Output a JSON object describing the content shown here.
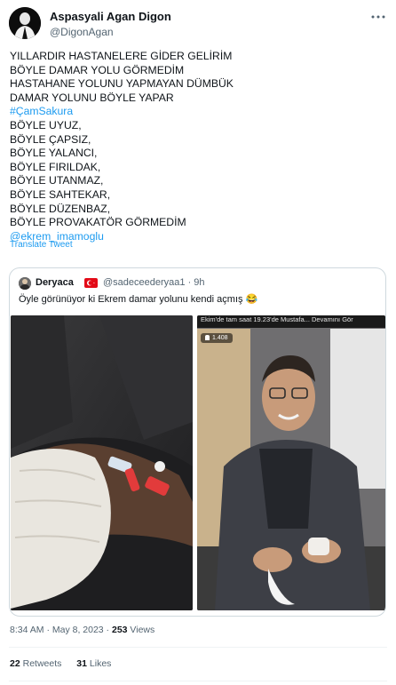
{
  "tweet": {
    "author": {
      "display_name": "Aspasyali Agan Digon",
      "handle": "@DigonAgan"
    },
    "lines": [
      "YILLARDIR HASTANELERE GİDER GELİRİM",
      "BÖYLE DAMAR YOLU GÖRMEDİM",
      "HASTAHANE YOLUNU YAPMAYAN DÜMBÜK",
      "DAMAR YOLUNU BÖYLE YAPAR"
    ],
    "hashtag": "#ÇamSakura",
    "lines2": [
      "BÖYLE UYUZ,",
      "BÖYLE ÇAPSIZ,",
      "BÖYLE YALANCI,",
      "BÖYLE FIRILDAK,",
      "BÖYLE UTANMAZ,",
      "BÖYLE SAHTEKAR,",
      "BÖYLE DÜZENBAZ,",
      "BÖYLE PROVAKATÖR GÖRMEDİM"
    ],
    "mention": "@ekrem_imamoglu",
    "translate_label": "Translate Tweet",
    "timestamp": "8:34 AM · May 8, 2023 · ",
    "views_count": "253",
    "views_label": " Views",
    "retweets_count": "22",
    "retweets_label": " Retweets",
    "likes_count": "31",
    "likes_label": " Likes"
  },
  "quote": {
    "display_name": "Deryaca",
    "handle_time": "@sadeceederyaa1 · 9h",
    "text": "Öyle görünüyor ki Ekrem damar yolunu kendi açmış 😂",
    "video_caption": "Ekim'de tam saat 19.23'de Mustafa... Devamını Gör",
    "viewer_count": "1.408"
  },
  "icons": {
    "more": "more-dots-icon",
    "flag": "turkey-flag-icon",
    "viewers": "person-icon"
  },
  "colors": {
    "link": "#1d9bf0",
    "secondary_text": "#536471",
    "border": "#cfd9de"
  }
}
